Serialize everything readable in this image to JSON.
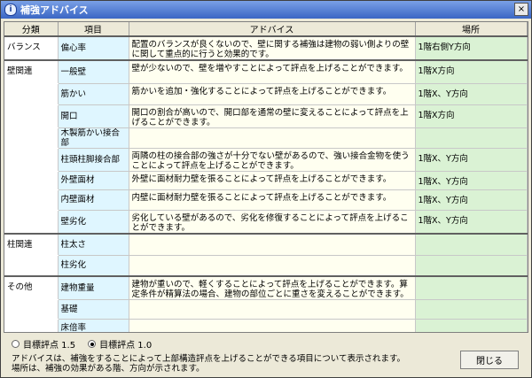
{
  "window": {
    "title": "補強アドバイス",
    "close_glyph": "×"
  },
  "headers": {
    "category": "分類",
    "item": "項目",
    "advice": "アドバイス",
    "location": "場所"
  },
  "rows": [
    {
      "category": "バランス",
      "item": "偏心率",
      "advice": "配置のバランスが良くないので、壁に関する補強は建物の弱い側よりの壁に関して重点的に行うと効果的です。",
      "location": "1階右側Y方向",
      "group_start": true
    },
    {
      "category": "壁関連",
      "item": "一般壁",
      "advice": "壁が少ないので、壁を増やすことによって評点を上げることができます。",
      "location": "1階X方向",
      "group_start": true
    },
    {
      "category": "",
      "item": "筋かい",
      "advice": "筋かいを追加・強化することによって評点を上げることができます。",
      "location": "1階X、Y方向"
    },
    {
      "category": "",
      "item": "開口",
      "advice": "開口の割合が高いので、開口部を通常の壁に変えることによって評点を上げることができます。",
      "location": "1階X方向"
    },
    {
      "category": "",
      "item": "木製筋かい接合部",
      "advice": "",
      "location": ""
    },
    {
      "category": "",
      "item": "柱頭柱脚接合部",
      "advice": "両隣の柱の接合部の強さが十分でない壁があるので、強い接合金物を使うことによって評点を上げることができます。",
      "location": "1階X、Y方向"
    },
    {
      "category": "",
      "item": "外壁面材",
      "advice": "外壁に面材耐力壁を張ることによって評点を上げることができます。",
      "location": "1階X、Y方向"
    },
    {
      "category": "",
      "item": "内壁面材",
      "advice": "内壁に面材耐力壁を張ることによって評点を上げることができます。",
      "location": "1階X、Y方向"
    },
    {
      "category": "",
      "item": "壁劣化",
      "advice": "劣化している壁があるので、劣化を修復することによって評点を上げることができます。",
      "location": "1階X、Y方向"
    },
    {
      "category": "柱関連",
      "item": "柱太さ",
      "advice": "",
      "location": "",
      "group_start": true
    },
    {
      "category": "",
      "item": "柱劣化",
      "advice": "",
      "location": ""
    },
    {
      "category": "その他",
      "item": "建物重量",
      "advice": "建物が重いので、軽くすることによって評点を上げることができます。算定条件が精算法の場合、建物の部位ごとに重さを変えることができます。",
      "location": "",
      "group_start": true
    },
    {
      "category": "",
      "item": "基礎",
      "advice": "",
      "location": ""
    },
    {
      "category": "",
      "item": "床倍率",
      "advice": "",
      "location": ""
    }
  ],
  "options": [
    {
      "label": "目標評点 1.5",
      "selected": false
    },
    {
      "label": "目標評点 1.0",
      "selected": true
    }
  ],
  "notes": {
    "line1": "アドバイスは、補強をすることによって上部構造評点を上げることができる項目について表示されます。",
    "line2": "場所は、補強の効果がある階、方向が示されます。"
  },
  "close_button": "閉じる"
}
